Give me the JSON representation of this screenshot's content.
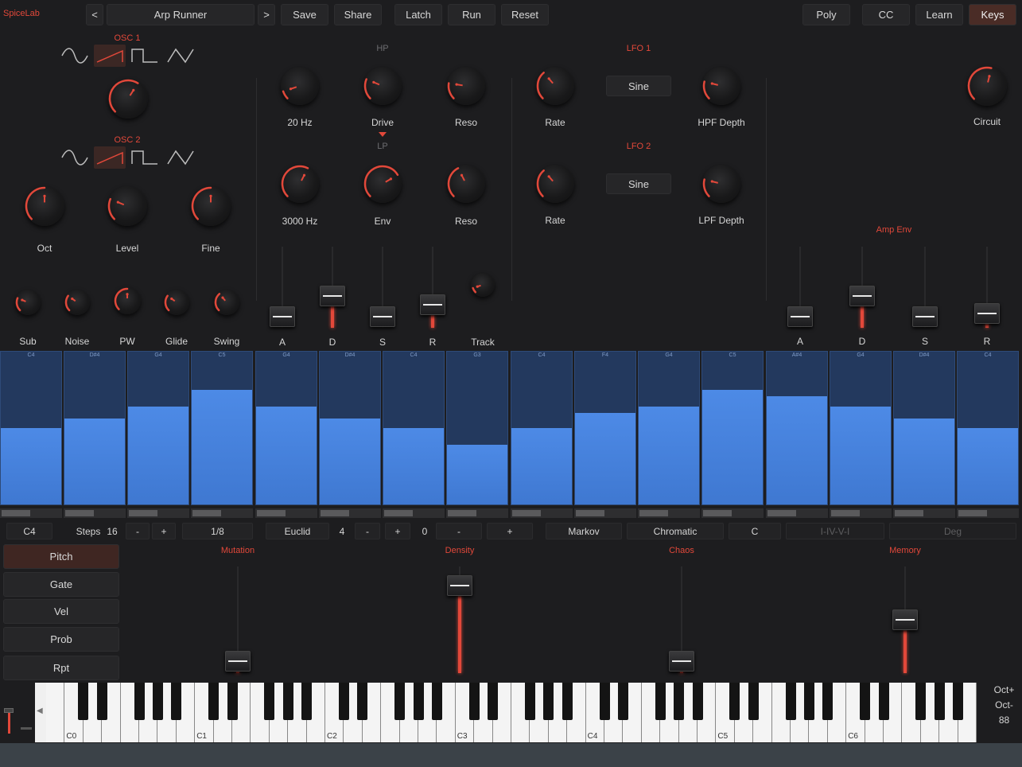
{
  "app_name": "SpiceLab",
  "toolbar": {
    "prev_label": "<",
    "preset_name": "Arp Runner",
    "next_label": ">",
    "save_label": "Save",
    "share_label": "Share",
    "latch_label": "Latch",
    "run_label": "Run",
    "reset_label": "Reset",
    "poly_label": "Poly",
    "cc_label": "CC",
    "learn_label": "Learn",
    "keys_label": "Keys"
  },
  "osc": {
    "osc1_title": "OSC 1",
    "osc2_title": "OSC 2",
    "osc1_selected_wave": "saw",
    "osc2_selected_wave": "saw",
    "oct_label": "Oct",
    "level_label": "Level",
    "fine_label": "Fine",
    "sub_label": "Sub",
    "noise_label": "Noise",
    "pw_label": "PW",
    "glide_label": "Glide",
    "swing_label": "Swing"
  },
  "filter": {
    "hp_title": "HP",
    "lp_title": "LP",
    "hp_freq_label": "20 Hz",
    "drive_label": "Drive",
    "hp_reso_label": "Reso",
    "lp_freq_label": "3000 Hz",
    "env_label": "Env",
    "lp_reso_label": "Reso",
    "track_label": "Track",
    "a_label": "A",
    "d_label": "D",
    "s_label": "S",
    "r_label": "R"
  },
  "lfo": {
    "lfo1_title": "LFO 1",
    "lfo2_title": "LFO 2",
    "lfo1_wave": "Sine",
    "lfo2_wave": "Sine",
    "rate1_label": "Rate",
    "rate2_label": "Rate",
    "hpf_depth_label": "HPF Depth",
    "lpf_depth_label": "LPF Depth"
  },
  "amp": {
    "circuit_label": "Circuit",
    "amp_env_title": "Amp Env",
    "a_label": "A",
    "d_label": "D",
    "s_label": "S",
    "r_label": "R"
  },
  "steps": [
    {
      "note": "C4",
      "level": 0.5
    },
    {
      "note": "D#4",
      "level": 0.56
    },
    {
      "note": "G4",
      "level": 0.64
    },
    {
      "note": "C5",
      "level": 0.75
    },
    {
      "note": "G4",
      "level": 0.64
    },
    {
      "note": "D#4",
      "level": 0.56
    },
    {
      "note": "C4",
      "level": 0.5
    },
    {
      "note": "G3",
      "level": 0.39
    },
    {
      "note": "C4",
      "level": 0.5
    },
    {
      "note": "F4",
      "level": 0.6
    },
    {
      "note": "G4",
      "level": 0.64
    },
    {
      "note": "C5",
      "level": 0.75
    },
    {
      "note": "A#4",
      "level": 0.71
    },
    {
      "note": "G4",
      "level": 0.64
    },
    {
      "note": "D#4",
      "level": 0.56
    },
    {
      "note": "C4",
      "level": 0.5
    }
  ],
  "seq_controls": {
    "root": "C4",
    "steps_label": "Steps",
    "steps_value": "16",
    "minus": "-",
    "plus": "+",
    "rate": "1/8",
    "euclid_label": "Euclid",
    "euclid_value": "4",
    "offset_value": "0",
    "markov_label": "Markov",
    "scale_label": "Chromatic",
    "key_label": "C",
    "progression_label": "I-IV-V-I",
    "deg_label": "Deg"
  },
  "lanes": {
    "pitch": "Pitch",
    "gate": "Gate",
    "vel": "Vel",
    "prob": "Prob",
    "rpt": "Rpt"
  },
  "macros": {
    "mutation_label": "Mutation",
    "density_label": "Density",
    "chaos_label": "Chaos",
    "memory_label": "Memory",
    "mutation_value": 0.1,
    "density_value": 0.9,
    "chaos_value": 0.1,
    "memory_value": 0.5
  },
  "keyboard": {
    "octave_labels": [
      "C0",
      "C1",
      "C2",
      "C3",
      "C4",
      "C5",
      "C6"
    ],
    "oct_up_label": "Oct+",
    "oct_down_label": "Oct-",
    "velocity_value": "88"
  },
  "colors": {
    "accent": "#e2483a",
    "step_fill": "#4a86e0",
    "background": "#1d1d1f"
  }
}
